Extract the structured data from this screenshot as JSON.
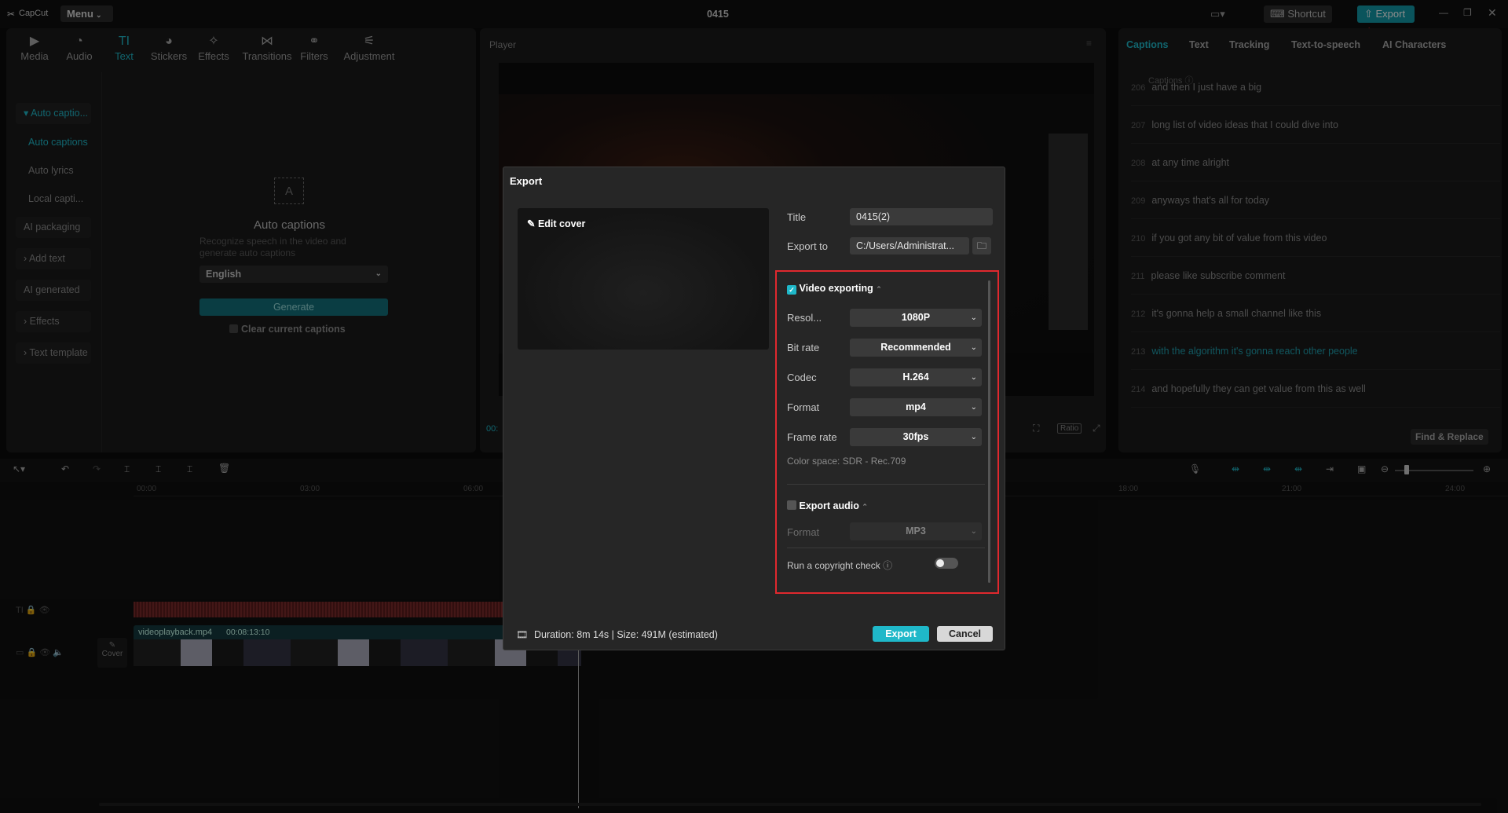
{
  "app": {
    "logo": "CapCut",
    "menu": "Menu",
    "project_title": "0415",
    "shortcut": "Shortcut",
    "export": "Export"
  },
  "toolbar": [
    "Media",
    "Audio",
    "Text",
    "Stickers",
    "Effects",
    "Transitions",
    "Filters",
    "Adjustment"
  ],
  "left_sidebar": {
    "auto_captions_group": "Auto captio...",
    "items": [
      "Auto captions",
      "Auto lyrics",
      "Local capti..."
    ],
    "ai_packaging": "AI packaging",
    "add_text": "Add text",
    "ai_generated": "AI generated",
    "effects": "Effects",
    "text_template": "Text template"
  },
  "auto_captions": {
    "title": "Auto captions",
    "desc_line1": "Recognize speech in the video and",
    "desc_line2": "generate auto captions",
    "language": "English",
    "generate": "Generate",
    "clear": "Clear current captions"
  },
  "player": {
    "label": "Player",
    "time": "00:",
    "ratio": "Ratio"
  },
  "right_panel": {
    "tabs": [
      "Captions",
      "Text",
      "Tracking",
      "Text-to-speech",
      "AI Characters"
    ],
    "captions_label": "Captions",
    "find_replace": "Find & Replace",
    "captions": [
      {
        "n": "206",
        "t": "and then I just have a big"
      },
      {
        "n": "207",
        "t": "long list of video ideas that I could dive into"
      },
      {
        "n": "208",
        "t": "at any time alright"
      },
      {
        "n": "209",
        "t": "anyways that's all for today"
      },
      {
        "n": "210",
        "t": "if you got any bit of value from this video"
      },
      {
        "n": "211",
        "t": "please like subscribe comment"
      },
      {
        "n": "212",
        "t": "it's gonna help a small channel like this"
      },
      {
        "n": "213",
        "t": "with the algorithm it's gonna reach other people"
      },
      {
        "n": "214",
        "t": "and hopefully they can get value from this as well"
      }
    ]
  },
  "timeline": {
    "ticks": [
      "00:00",
      "03:00",
      "06:00",
      "18:00",
      "21:00",
      "24:00"
    ],
    "clip_name": "videoplayback.mp4",
    "clip_duration": "00:08:13:10",
    "cover": "Cover"
  },
  "dialog": {
    "title": "Export",
    "edit_cover": "Edit cover",
    "title_label": "Title",
    "title_value": "0415(2)",
    "export_to_label": "Export to",
    "export_to_value": "C:/Users/Administrat...",
    "video_exporting": "Video exporting",
    "settings": [
      {
        "label": "Resol...",
        "value": "1080P"
      },
      {
        "label": "Bit rate",
        "value": "Recommended"
      },
      {
        "label": "Codec",
        "value": "H.264"
      },
      {
        "label": "Format",
        "value": "mp4"
      },
      {
        "label": "Frame rate",
        "value": "30fps"
      }
    ],
    "color_space": "Color space: SDR - Rec.709",
    "export_audio": "Export audio",
    "audio_format_label": "Format",
    "audio_format_value": "MP3",
    "copyright": "Run a copyright check",
    "duration": "Duration: 8m 14s | Size: 491M (estimated)",
    "export_btn": "Export",
    "cancel_btn": "Cancel"
  },
  "colors": {
    "accent": "#1fb8c9",
    "highlight": "#e0282e"
  }
}
